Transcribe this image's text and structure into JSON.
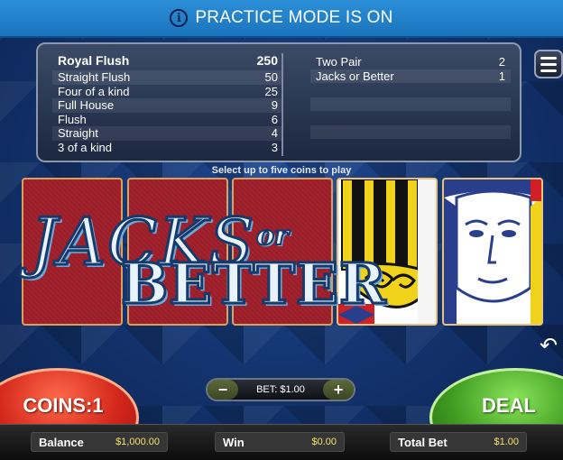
{
  "banner": {
    "text": "PRACTICE MODE IS ON",
    "icon": "info-icon"
  },
  "paytable": {
    "left": [
      {
        "hand": "Royal Flush",
        "pay": "250"
      },
      {
        "hand": "Straight Flush",
        "pay": "50"
      },
      {
        "hand": "Four of a kind",
        "pay": "25"
      },
      {
        "hand": "Full House",
        "pay": "9"
      },
      {
        "hand": "Flush",
        "pay": "6"
      },
      {
        "hand": "Straight",
        "pay": "4"
      },
      {
        "hand": "3 of a kind",
        "pay": "3"
      }
    ],
    "right": [
      {
        "hand": "Two Pair",
        "pay": "2"
      },
      {
        "hand": "Jacks or Better",
        "pay": "1"
      }
    ]
  },
  "hint": "Select up to five coins to play",
  "cards": [
    {
      "type": "back"
    },
    {
      "type": "back"
    },
    {
      "type": "back"
    },
    {
      "type": "face",
      "desc": "jack-card"
    },
    {
      "type": "face",
      "desc": "jack-card"
    }
  ],
  "logo": {
    "word1": "JACKS",
    "word2": "or",
    "word3": "BETTER"
  },
  "controls": {
    "coins_label": "COINS:1",
    "deal_label": "DEAL",
    "bet_label": "BET: $1.00",
    "minus": "−",
    "plus": "+",
    "return_icon": "↶"
  },
  "status": {
    "balance_label": "Balance",
    "balance_value": "$1,000.00",
    "win_label": "Win",
    "win_value": "$0.00",
    "total_bet_label": "Total Bet",
    "total_bet_value": "$1.00"
  },
  "colors": {
    "banner": "#1a74bd",
    "coins": "#d3261b",
    "deal": "#3e9b20",
    "value_text": "#f4e26b"
  }
}
